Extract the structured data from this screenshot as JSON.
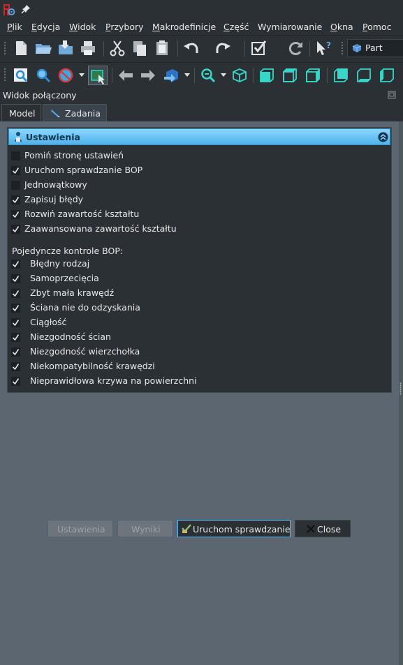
{
  "menubar": {
    "items": [
      {
        "underline": "P",
        "rest": "lik"
      },
      {
        "underline": "E",
        "rest": "dycja"
      },
      {
        "underline": "W",
        "rest": "idok"
      },
      {
        "underline": "P",
        "rest": "rzybory"
      },
      {
        "underline": "M",
        "rest": "akrodefinicje"
      },
      {
        "underline": "C",
        "rest": "zęść"
      },
      {
        "underline": "",
        "rest": "Wymiarowanie"
      },
      {
        "underline": "O",
        "rest": "kna"
      },
      {
        "underline": "P",
        "rest": "omoc"
      }
    ]
  },
  "toolbar": {
    "workbench": "Part"
  },
  "combo_view": {
    "title": "Widok połączony",
    "tabs": [
      "Model",
      "Zadania"
    ]
  },
  "task": {
    "header": "Ustawienia",
    "options": [
      {
        "label": "Pomiń stronę ustawień",
        "checked": false
      },
      {
        "label": "Uruchom sprawdzanie BOP",
        "checked": true
      },
      {
        "label": "Jednowątkowy",
        "checked": false
      },
      {
        "label": "Zapisuj błędy",
        "checked": true
      },
      {
        "label": "Rozwiń zawartość kształtu",
        "checked": true
      },
      {
        "label": "Zaawansowana zawartość kształtu",
        "checked": true
      }
    ],
    "bop_label": "Pojedyncze kontrole BOP:",
    "bop_checks": [
      {
        "label": "Błędny rodzaj",
        "checked": true
      },
      {
        "label": "Samoprzecięcia",
        "checked": true
      },
      {
        "label": "Zbyt mała krawędź",
        "checked": true
      },
      {
        "label": "Ściana nie do odzyskania",
        "checked": true
      },
      {
        "label": "Ciągłość",
        "checked": true
      },
      {
        "label": "Niezgodność ścian",
        "checked": true
      },
      {
        "label": "Niezgodność wierzchołka",
        "checked": true
      },
      {
        "label": "Niekompatybilność krawędzi",
        "checked": true
      },
      {
        "label": "Nieprawidłowa krzywa na powierzchni",
        "checked": true
      }
    ]
  },
  "buttons": {
    "settings": "Ustawienia",
    "results": "Wyniki",
    "run": "Uruchom sprawdzanie",
    "close": "Close"
  }
}
